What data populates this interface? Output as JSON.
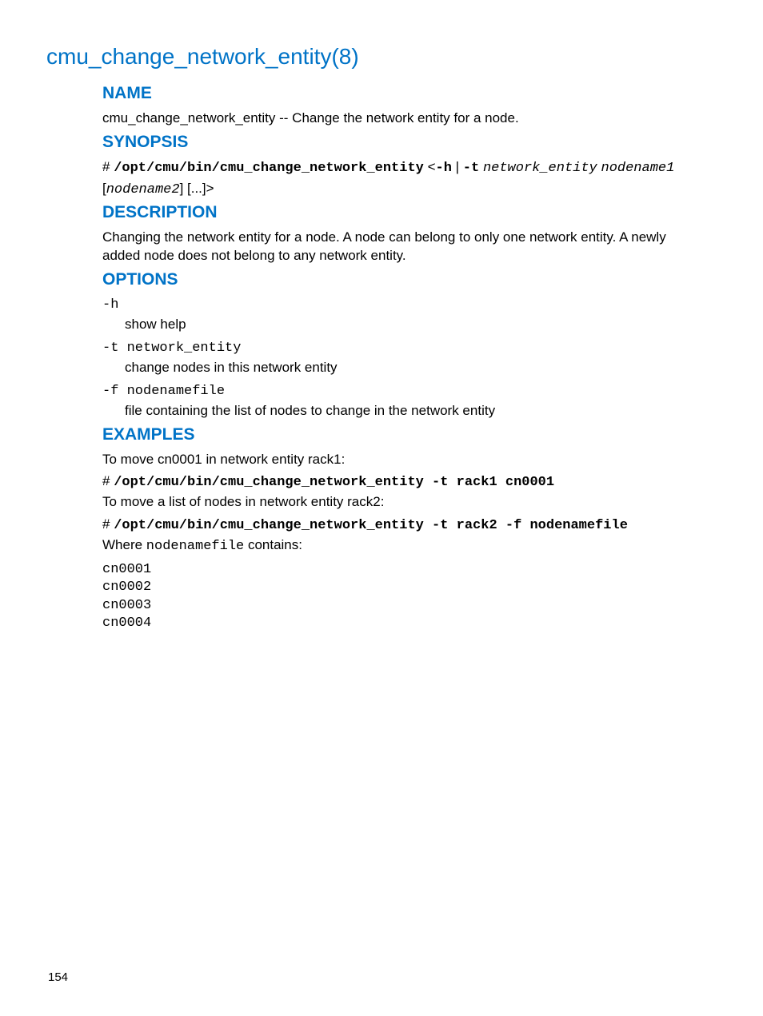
{
  "page_title": "cmu_change_network_entity(8)",
  "page_number": "154",
  "sections": {
    "name": {
      "heading": "NAME",
      "text": "cmu_change_network_entity -- Change the network entity for a node."
    },
    "synopsis": {
      "heading": "SYNOPSIS",
      "prefix": "# ",
      "cmd": "/opt/cmu/bin/cmu_change_network_entity",
      "lt": " <",
      "opt_h": "-h",
      "pipe": " | ",
      "opt_t": "-t",
      "space": " ",
      "arg_ne": "network_entity",
      "arg_n1": "nodename1",
      "line2_open": "[",
      "arg_n2": "nodename2",
      "line2_close": "] [...]>"
    },
    "description": {
      "heading": "DESCRIPTION",
      "text": "Changing the network entity for a node. A node can belong to only one network entity. A newly added node does not belong to any network entity."
    },
    "options": {
      "heading": "OPTIONS",
      "items": [
        {
          "term": "-h",
          "term_arg": "",
          "def": "show help"
        },
        {
          "term": "-t ",
          "term_arg": "network_entity",
          "def": "change nodes in this network entity"
        },
        {
          "term": "-f ",
          "term_arg": "nodenamefile",
          "def": "file containing the list of nodes to change in the network entity"
        }
      ]
    },
    "examples": {
      "heading": "EXAMPLES",
      "intro1": "To move cn0001 in network entity rack1:",
      "cmd1_prefix": "# ",
      "cmd1": "/opt/cmu/bin/cmu_change_network_entity -t rack1 cn0001",
      "intro2": "To move a list of nodes in network entity rack2:",
      "cmd2_prefix": "# ",
      "cmd2": "/opt/cmu/bin/cmu_change_network_entity -t rack2 -f nodenamefile",
      "where_pre": "Where ",
      "where_mono": "nodenamefile",
      "where_post": " contains:",
      "nodelist": "cn0001\ncn0002\ncn0003\ncn0004"
    }
  }
}
